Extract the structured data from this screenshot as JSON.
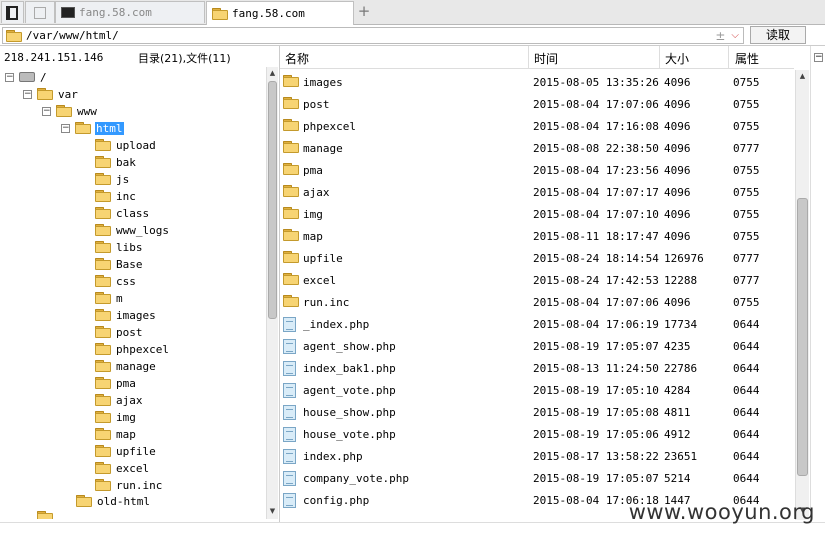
{
  "tabs": [
    {
      "label": "",
      "icon": "panel-icon"
    },
    {
      "label": "",
      "icon": "blank-page-icon"
    },
    {
      "label": "fang.58.com",
      "icon": "terminal-icon"
    },
    {
      "label": "fang.58.com",
      "icon": "folder-icon",
      "active": true
    }
  ],
  "add_tab_label": "+",
  "path_bar": {
    "value": "/var/www/html/",
    "read_button": "读取",
    "encoding_icon": "±",
    "dropdown_icon": "chevron-down-icon"
  },
  "info": {
    "ip": "218.241.151.146",
    "counts": "目录(21),文件(11)"
  },
  "tree": {
    "root": "/",
    "var": "var",
    "www": "www",
    "html": "html",
    "children": [
      "upload",
      "bak",
      "js",
      "inc",
      "class",
      "www_logs",
      "libs",
      "Base",
      "css",
      "m",
      "images",
      "post",
      "phpexcel",
      "manage",
      "pma",
      "ajax",
      "img",
      "map",
      "upfile",
      "excel",
      "run.inc"
    ],
    "sibling": "old-html"
  },
  "columns": {
    "name": "名称",
    "time": "时间",
    "size": "大小",
    "attr": "属性"
  },
  "files": [
    {
      "name": "images",
      "time": "2015-08-05 13:35:26",
      "size": "4096",
      "attr": "0755",
      "type": "folder"
    },
    {
      "name": "post",
      "time": "2015-08-04 17:07:06",
      "size": "4096",
      "attr": "0755",
      "type": "folder"
    },
    {
      "name": "phpexcel",
      "time": "2015-08-04 17:16:08",
      "size": "4096",
      "attr": "0755",
      "type": "folder"
    },
    {
      "name": "manage",
      "time": "2015-08-08 22:38:50",
      "size": "4096",
      "attr": "0777",
      "type": "folder"
    },
    {
      "name": "pma",
      "time": "2015-08-04 17:23:56",
      "size": "4096",
      "attr": "0755",
      "type": "folder"
    },
    {
      "name": "ajax",
      "time": "2015-08-04 17:07:17",
      "size": "4096",
      "attr": "0755",
      "type": "folder"
    },
    {
      "name": "img",
      "time": "2015-08-04 17:07:10",
      "size": "4096",
      "attr": "0755",
      "type": "folder"
    },
    {
      "name": "map",
      "time": "2015-08-11 18:17:47",
      "size": "4096",
      "attr": "0755",
      "type": "folder"
    },
    {
      "name": "upfile",
      "time": "2015-08-24 18:14:54",
      "size": "126976",
      "attr": "0777",
      "type": "folder"
    },
    {
      "name": "excel",
      "time": "2015-08-24 17:42:53",
      "size": "12288",
      "attr": "0777",
      "type": "folder"
    },
    {
      "name": "run.inc",
      "time": "2015-08-04 17:07:06",
      "size": "4096",
      "attr": "0755",
      "type": "folder"
    },
    {
      "name": "_index.php",
      "time": "2015-08-04 17:06:19",
      "size": "17734",
      "attr": "0644",
      "type": "file"
    },
    {
      "name": "agent_show.php",
      "time": "2015-08-19 17:05:07",
      "size": "4235",
      "attr": "0644",
      "type": "file"
    },
    {
      "name": "index_bak1.php",
      "time": "2015-08-13 11:24:50",
      "size": "22786",
      "attr": "0644",
      "type": "file"
    },
    {
      "name": "agent_vote.php",
      "time": "2015-08-19 17:05:10",
      "size": "4284",
      "attr": "0644",
      "type": "file"
    },
    {
      "name": "house_show.php",
      "time": "2015-08-19 17:05:08",
      "size": "4811",
      "attr": "0644",
      "type": "file"
    },
    {
      "name": "house_vote.php",
      "time": "2015-08-19 17:05:06",
      "size": "4912",
      "attr": "0644",
      "type": "file"
    },
    {
      "name": "index.php",
      "time": "2015-08-17 13:58:22",
      "size": "23651",
      "attr": "0644",
      "type": "file"
    },
    {
      "name": "company_vote.php",
      "time": "2015-08-19 17:05:07",
      "size": "5214",
      "attr": "0644",
      "type": "file"
    },
    {
      "name": "config.php",
      "time": "2015-08-04 17:06:18",
      "size": "1447",
      "attr": "0644",
      "type": "file"
    }
  ],
  "watermark": "www.wooyun.org",
  "colors": {
    "selection": "#3399ff",
    "folder": "#f7d473",
    "accent_red": "#d04040"
  }
}
